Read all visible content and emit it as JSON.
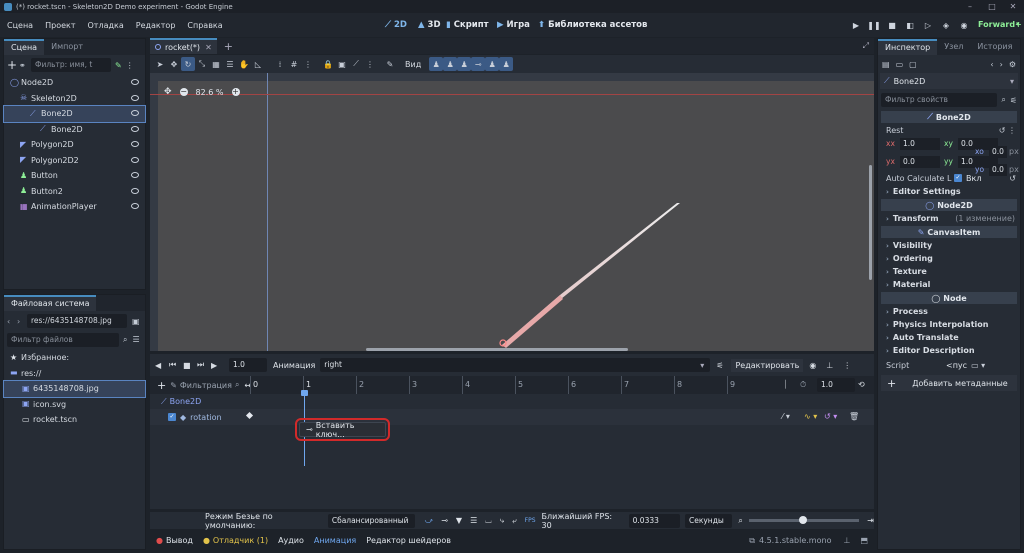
{
  "window": {
    "title": "(*) rocket.tscn - Skeleton2D Demo experiment - Godot Engine",
    "buttons": [
      "–",
      "□",
      "✕"
    ]
  },
  "menu": [
    "Сцена",
    "Проект",
    "Отладка",
    "Редактор",
    "Справка"
  ],
  "workspaces": [
    {
      "glyph": "⟋",
      "label": "2D"
    },
    {
      "glyph": "▲",
      "label": "3D"
    },
    {
      "glyph": "▮",
      "label": "Скрипт"
    },
    {
      "glyph": "▶",
      "label": "Игра"
    },
    {
      "glyph": "⬆",
      "label": "Библиотека ассетов"
    }
  ],
  "renderer": "Forward+",
  "scene_panel": {
    "tabs": [
      "Сцена",
      "Импорт"
    ],
    "filter_placeholder": "Фильтр: имя, t",
    "nodes": [
      {
        "label": "Node2D",
        "icon": "node2d-icon",
        "color": "#8da5f3",
        "depth": 0
      },
      {
        "label": "Skeleton2D",
        "icon": "skeleton-icon",
        "color": "#8da5f3",
        "depth": 1
      },
      {
        "label": "Bone2D",
        "icon": "bone-icon",
        "color": "#8da5f3",
        "depth": 2,
        "selected": true
      },
      {
        "label": "Bone2D",
        "icon": "bone-icon",
        "color": "#8da5f3",
        "depth": 3
      },
      {
        "label": "Polygon2D",
        "icon": "polygon-icon",
        "color": "#8da5f3",
        "depth": 1
      },
      {
        "label": "Polygon2D2",
        "icon": "polygon-icon",
        "color": "#8da5f3",
        "depth": 1
      },
      {
        "label": "Button",
        "icon": "control-icon",
        "color": "#8eef97",
        "depth": 1
      },
      {
        "label": "Button2",
        "icon": "control-icon",
        "color": "#8eef97",
        "depth": 1
      },
      {
        "label": "AnimationPlayer",
        "icon": "animation-icon",
        "color": "#c38ef1",
        "depth": 1
      }
    ]
  },
  "fs_panel": {
    "title": "Файловая система",
    "path": "res://6435148708.jpg",
    "filter_placeholder": "Фильтр файлов",
    "items": [
      {
        "label": "Избранное:",
        "icon": "star-icon",
        "depth": 0
      },
      {
        "label": "res://",
        "icon": "folder-icon",
        "depth": 0
      },
      {
        "label": "6435148708.jpg",
        "icon": "image-icon",
        "depth": 1,
        "selected": true
      },
      {
        "label": "icon.svg",
        "icon": "image-icon",
        "depth": 1
      },
      {
        "label": "rocket.tscn",
        "icon": "scene-icon",
        "depth": 1
      }
    ]
  },
  "scene_tab": "rocket(*)",
  "viewport": {
    "zoom": "82.6 %",
    "toolbar_view_label": "Вид"
  },
  "animation": {
    "step": "1.0",
    "anim_label": "Анимация",
    "anim_name": "right",
    "edit_label": "Редактировать",
    "filter_label": "Фильтрация",
    "track_group": "Bone2D",
    "track": "rotation",
    "ticks": [
      "0",
      "1",
      "2",
      "3",
      "4",
      "5",
      "6",
      "7",
      "8",
      "9"
    ],
    "end_time": "1.0",
    "popup": "Вставить ключ...",
    "cur_time": "1"
  },
  "anim_bottom": {
    "bezier_label": "Режим Безье по умолчанию:",
    "bezier_value": "Сбалансированный",
    "fps_label": "Ближайший FPS: 30",
    "fps_value": "0.0333",
    "unit": "Секунды"
  },
  "bottom_tabs": {
    "output": "Вывод",
    "debugger": "Отладчик (1)",
    "audio": "Аудио",
    "animation": "Анимация",
    "shader": "Редактор шейдеров",
    "version": "4.5.1.stable.mono"
  },
  "inspector": {
    "tabs": [
      "Инспектор",
      "Узел",
      "История"
    ],
    "object": "Bone2D",
    "filter_placeholder": "Фильтр свойств",
    "class_header": "Bone2D",
    "rest_label": "Rest",
    "rest": {
      "xx": "1.0",
      "xy": "0.0",
      "xo": "0.0",
      "yx": "0.0",
      "yy": "1.0",
      "yo": "0.0"
    },
    "px": "px",
    "auto_calc_label": "Auto Calculate L",
    "auto_calc_value": "Вкл",
    "editor_settings": "Editor Settings",
    "node2d_header": "Node2D",
    "transform": "Transform",
    "transform_note": "(1 изменение)",
    "canvas_header": "CanvasItem",
    "canvas_sections": [
      "Visibility",
      "Ordering",
      "Texture",
      "Material"
    ],
    "node_header": "Node",
    "node_sections": [
      "Process",
      "Physics Interpolation",
      "Auto Translate",
      "Editor Description"
    ],
    "script_label": "Script",
    "script_value": "<пус",
    "add_meta": "Добавить метаданные"
  }
}
